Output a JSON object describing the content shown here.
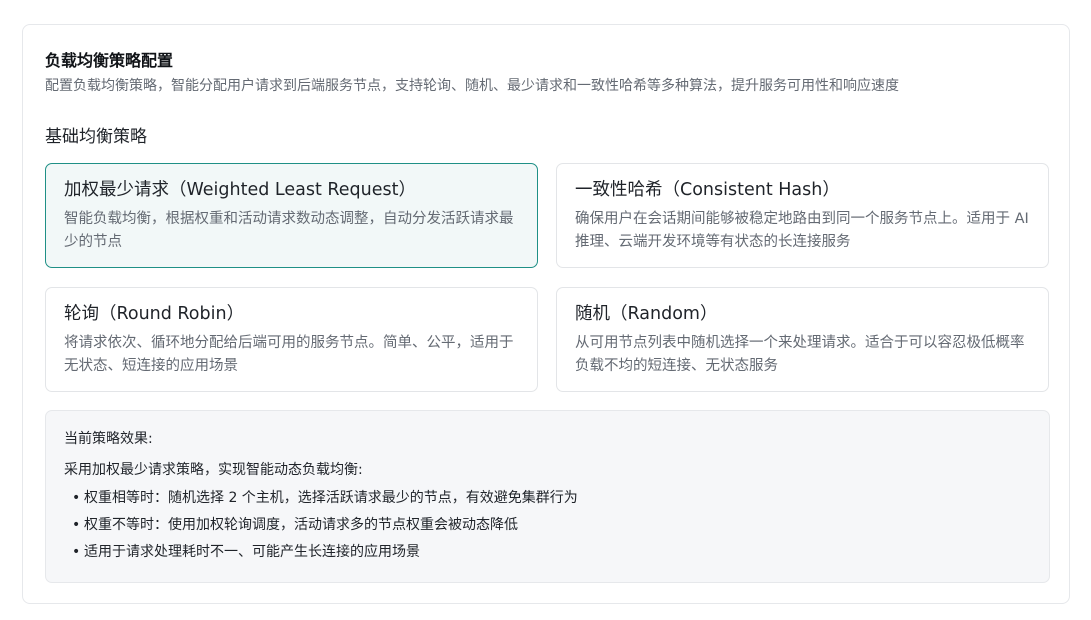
{
  "header": {
    "title": "负载均衡策略配置",
    "description": "配置负载均衡策略，智能分配用户请求到后端服务节点，支持轮询、随机、最少请求和一致性哈希等多种算法，提升服务可用性和响应速度"
  },
  "basic": {
    "section_title": "基础均衡策略",
    "selected_index": 0,
    "options": [
      {
        "title": "加权最少请求（Weighted Least Request）",
        "description": "智能负载均衡，根据权重和活动请求数动态调整，自动分发活跃请求最少的节点"
      },
      {
        "title": "一致性哈希（Consistent Hash）",
        "description": "确保用户在会话期间能够被稳定地路由到同一个服务节点上。适用于 AI 推理、云端开发环境等有状态的长连接服务"
      },
      {
        "title": "轮询（Round Robin）",
        "description": "将请求依次、循环地分配给后端可用的服务节点。简单、公平，适用于无状态、短连接的应用场景"
      },
      {
        "title": "随机（Random）",
        "description": "从可用节点列表中随机选择一个来处理请求。适合于可以容忍极低概率负载不均的短连接、无状态服务"
      }
    ]
  },
  "effect": {
    "title": "当前策略效果:",
    "intro": "采用加权最少请求策略，实现智能动态负载均衡:",
    "bullet_symbol": "•",
    "bullets": [
      "权重相等时：随机选择 2 个主机，选择活跃请求最少的节点，有效避免集群行为",
      "权重不等时：使用加权轮询调度，活动请求多的节点权重会被动态降低",
      "适用于请求处理耗时不一、可能产生长连接的应用场景"
    ]
  },
  "colors": {
    "selected_border": "#1f9086",
    "selected_background": "#f2f8f8",
    "muted_text": "#646a73"
  }
}
